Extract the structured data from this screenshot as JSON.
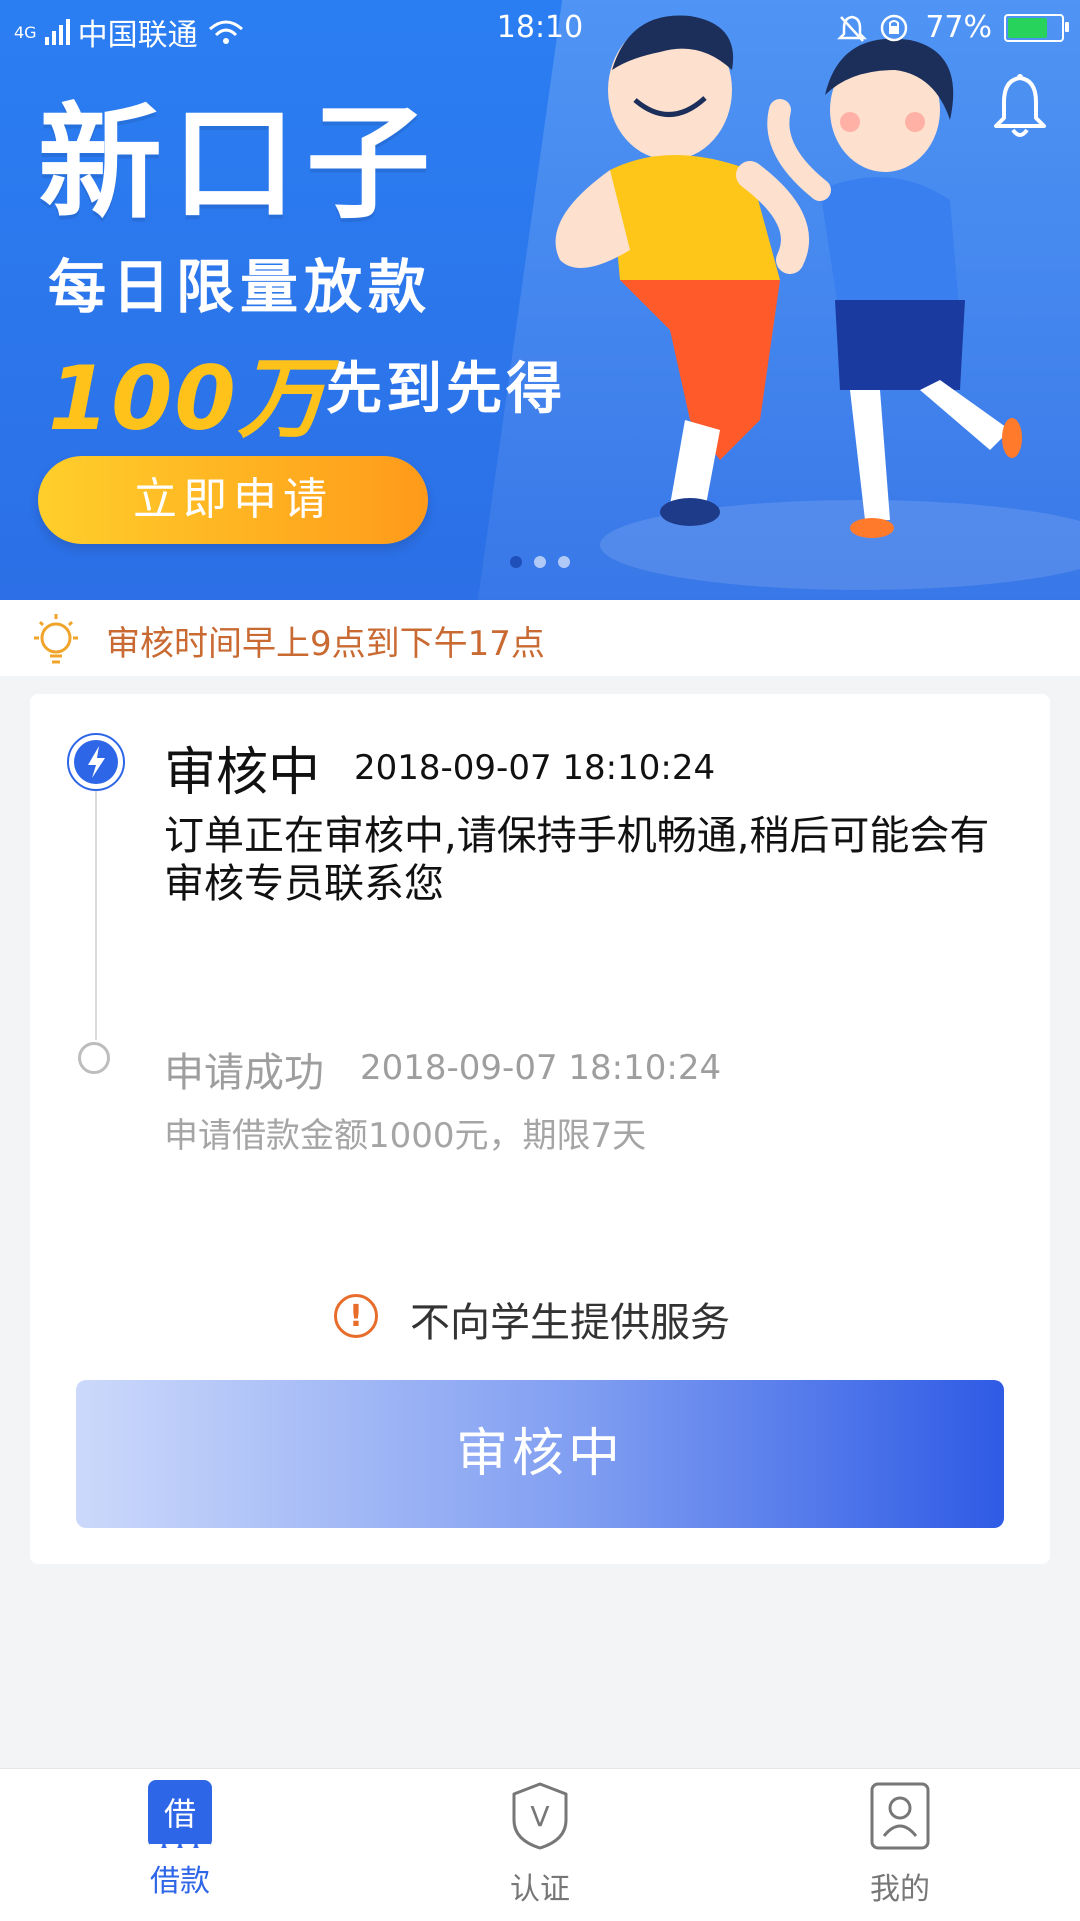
{
  "status_bar": {
    "network": "4G",
    "carrier": "中国联通",
    "time": "18:10",
    "battery": "77%"
  },
  "banner": {
    "title": "新口子",
    "subtitle1": "每日限量放款",
    "amount": "100万",
    "subtitle2": "先到先得",
    "apply_button": "立即申请",
    "colors": {
      "background": "#2b7ef2",
      "accent": "#ffc21a"
    }
  },
  "notice": {
    "text": "审核时间早上9点到下午17点"
  },
  "timeline": {
    "step1": {
      "title": "审核中",
      "time": "2018-09-07 18:10:24",
      "desc": "订单正在审核中,请保持手机畅通,稍后可能会有审核专员联系您"
    },
    "step2": {
      "title": "申请成功",
      "time": "2018-09-07 18:10:24",
      "desc": "申请借款金额1000元，期限7天"
    }
  },
  "warning": {
    "icon_text": "!",
    "text": "不向学生提供服务"
  },
  "status_button": {
    "label": "审核中"
  },
  "bottom_nav": {
    "loan": {
      "icon_text": "借",
      "label": "借款"
    },
    "auth": {
      "icon_text": "V",
      "label": "认证"
    },
    "mine": {
      "label": "我的"
    }
  }
}
